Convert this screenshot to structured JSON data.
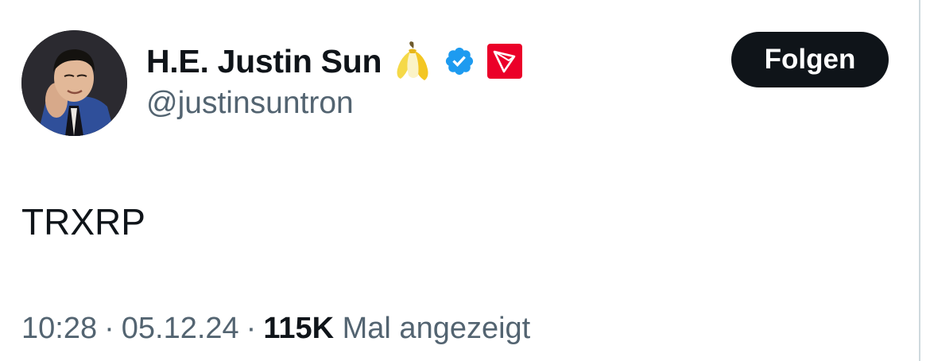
{
  "user": {
    "display_name": "H.E. Justin Sun",
    "handle": "@justinsuntron"
  },
  "follow_button": {
    "label": "Folgen"
  },
  "tweet": {
    "text": "TRXRP",
    "time": "10:28",
    "date": "05.12.24",
    "separator": "·",
    "views_count": "115K",
    "views_label": "Mal angezeigt"
  },
  "icons": {
    "emoji": "banana-icon",
    "badge": "verified-badge-icon",
    "affiliate": "tron-logo-icon"
  },
  "colors": {
    "verified_blue": "#1d9bf0",
    "tron_red": "#eb0029",
    "secondary_text": "#536471",
    "primary_text": "#0f1419"
  }
}
